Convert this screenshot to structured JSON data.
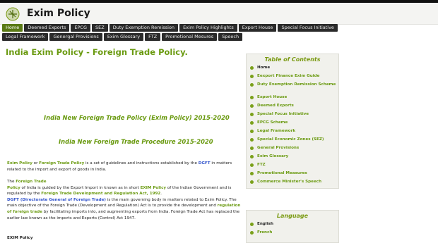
{
  "header": {
    "title": "Exim Policy"
  },
  "nav": {
    "row1": [
      "Home",
      "Deemed Exports",
      "EPCG",
      "SEZ",
      "Duty Exemption Remission",
      "Exim Policy Highlights",
      "Export House",
      "Special Focus Initiative"
    ],
    "row2": [
      "Legal Framework",
      "Genergal Provisions",
      "Exim Glossary",
      "FTZ",
      "Promotional Mesures",
      "Speech"
    ]
  },
  "main": {
    "title": "India Exim Policy - Foreign Trade Policy.",
    "sub1": "India New Foreign Trade Policy (Exim Policy) 2015-2020",
    "sub2": "India New Foreign Trade Procedure 2015-2020",
    "p1": {
      "a": "Exim Policy",
      "b": " or ",
      "c": "Foreign Trade Policy",
      "d": " is a set of guidelines and instructions established by the ",
      "e": "DGFT",
      "f": " in matters related to the import and export of goods in India."
    },
    "p2": {
      "a": "The ",
      "b": "Foreign Trade",
      "c": "Policy",
      "d": " of India is guided by the Export Import in known as in short ",
      "e": "EXIM Policy",
      "f": " of the Indian Government and is regulated by the ",
      "g": "Foreign Trade Development and Regulation Act, 1992",
      "h": ".",
      "i": "DGFT (Directorate General of Foreign Trade)",
      "j": " is the main governing body in matters related to Exim Policy. The main objective of the Foreign Trade (Development and Regulation) Act is to provide the development and ",
      "k": "regulation of foreign trade",
      "l": " by facilitating imports into, and augmenting exports from India. Foreign Trade Act has replaced the earlier law known as the imports and Exports (Control) Act 1947."
    },
    "p3": "EXIM Policy"
  },
  "sidebar": {
    "title": "Table of Contents",
    "items": [
      "Home",
      "Eexport Finance Exim Guide",
      "Duty Exemption Remission Scheme",
      "Export House",
      "Deemed Exports",
      "Special Focus Initiative",
      "EPCG Scheme",
      "Legal Framework",
      "Special Economic Zones (SEZ)",
      "General Provisions",
      "Exim Glossary",
      "FTZ",
      "Promotional Measures",
      "Commerce Minister's Speech"
    ]
  },
  "language": {
    "title": "Language",
    "items": [
      "English",
      "French"
    ]
  }
}
